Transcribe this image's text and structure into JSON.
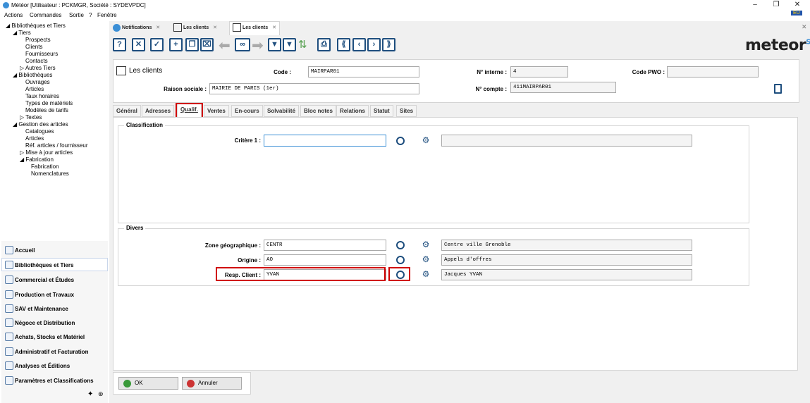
{
  "window": {
    "title": "Météor [Utilisateur : PCKMGR, Société : SYDEVPDC]",
    "lang_badge": "EU"
  },
  "menu": [
    "Actions",
    "Commandes",
    "Sortie",
    "?",
    "Fenêtre"
  ],
  "tree": [
    "Bibliothèques et Tiers",
    "Tiers",
    "Prospects",
    "Clients",
    "Fournisseurs",
    "Contacts",
    "Autres Tiers",
    "Bibliothèques",
    "Ouvrages",
    "Articles",
    "Taux horaires",
    "Types de matériels",
    "Modèles de tarifs",
    "Textes",
    "Gestion des articles",
    "Catalogues",
    "Articles",
    "Réf. articles / fournisseur",
    "Mise à jour articles",
    "Fabrication",
    "Fabrication",
    "Nomenclatures"
  ],
  "nav": [
    "Accueil",
    "Bibliothèques et Tiers",
    "Commercial et Études",
    "Production et Travaux",
    "SAV et Maintenance",
    "Négoce et Distribution",
    "Achats, Stocks et Matériel",
    "Administratif et Facturation",
    "Analyses et Éditions",
    "Paramètres et Classifications"
  ],
  "tabs": [
    "Notifications",
    "Les clients",
    "Les clients"
  ],
  "logo": "meteor",
  "header": {
    "title": "Les clients",
    "code_label": "Code :",
    "code": "MAIRPAR01",
    "raison_label": "Raison sociale :",
    "raison": "MAIRIE DE PARIS (1er)",
    "interne_label": "N° interne :",
    "interne": "4",
    "compte_label": "N° compte :",
    "compte": "411MAIRPAR01",
    "pwo_label": "Code PWO :",
    "pwo": ""
  },
  "subtabs": [
    "Général",
    "Adresses",
    "Qualif.",
    "Ventes",
    "En-cours",
    "Solvabilité",
    "Bloc notes",
    "Relations",
    "Statut",
    "Sites"
  ],
  "classification": {
    "title": "Classification",
    "critere_label": "Critère 1 :",
    "critere": "",
    "critere_desc": ""
  },
  "divers": {
    "title": "Divers",
    "rows": [
      {
        "label": "Zone géographique :",
        "value": "CENTR",
        "desc": "Centre ville Grenoble"
      },
      {
        "label": "Origine :",
        "value": "AO",
        "desc": "Appels d'offres"
      },
      {
        "label": "Resp. Client :",
        "value": "YVAN",
        "desc": "Jacques YVAN"
      }
    ]
  },
  "buttons": {
    "ok": "OK",
    "cancel": "Annuler"
  }
}
